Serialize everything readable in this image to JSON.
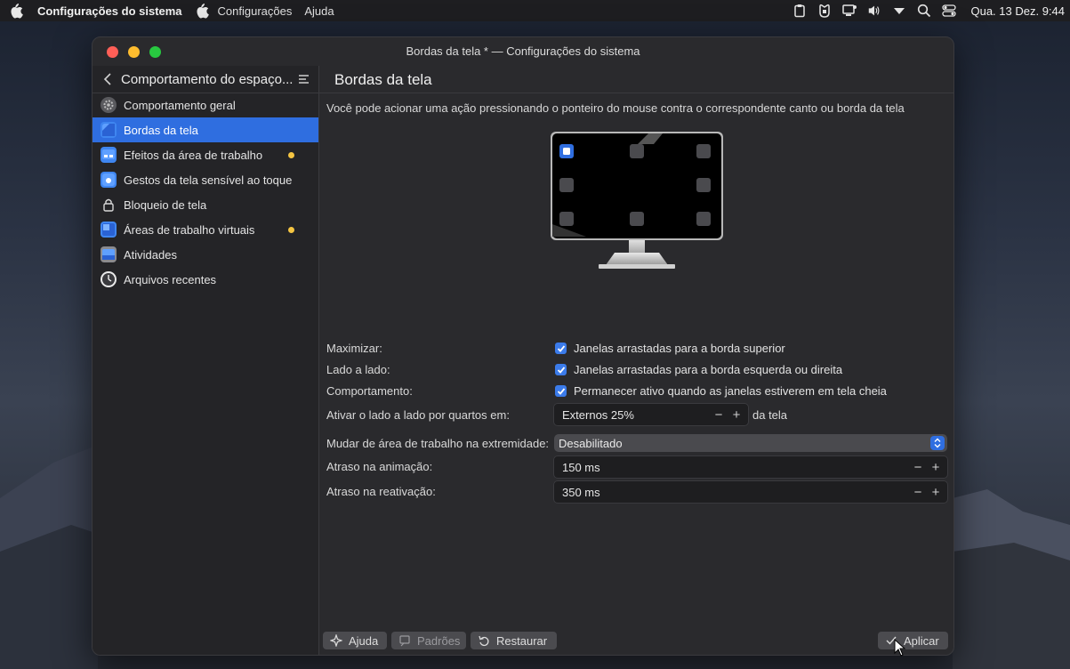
{
  "menubar": {
    "app_name": "Configurações do sistema",
    "items": [
      "Configurações",
      "Ajuda"
    ],
    "clock": "Qua. 13 Dez. 9:44"
  },
  "window": {
    "title": "Bordas da tela * — Configurações do sistema"
  },
  "sidebar": {
    "header": "Comportamento do espaço...",
    "items": [
      {
        "label": "Comportamento geral",
        "icon": "gear-icon",
        "active": false,
        "dot": false
      },
      {
        "label": "Bordas da tela",
        "icon": "screen-edges-icon",
        "active": true,
        "dot": false
      },
      {
        "label": "Efeitos da área de trabalho",
        "icon": "desktop-effects-icon",
        "active": false,
        "dot": true
      },
      {
        "label": "Gestos da tela sensível ao toque",
        "icon": "touch-gesture-icon",
        "active": false,
        "dot": false
      },
      {
        "label": "Bloqueio de tela",
        "icon": "lock-icon",
        "active": false,
        "dot": false
      },
      {
        "label": "Áreas de trabalho virtuais",
        "icon": "virtual-desktops-icon",
        "active": false,
        "dot": true
      },
      {
        "label": "Atividades",
        "icon": "activities-icon",
        "active": false,
        "dot": false
      },
      {
        "label": "Arquivos recentes",
        "icon": "clock-icon",
        "active": false,
        "dot": false
      }
    ]
  },
  "content": {
    "title": "Bordas da tela",
    "description": "Você pode acionar uma ação pressionando o ponteiro do mouse contra o correspondente canto ou borda da tela",
    "maximize": {
      "label": "Maximizar:",
      "text": "Janelas arrastadas para a borda superior",
      "checked": true
    },
    "tile": {
      "label": "Lado a lado:",
      "text": "Janelas arrastadas para a borda esquerda ou direita",
      "checked": true
    },
    "behavior": {
      "label": "Comportamento:",
      "text": "Permanecer ativo quando as janelas estiverem em tela cheia",
      "checked": true
    },
    "quarter": {
      "label": "Ativar o lado a lado por quartos em:",
      "value": "Externos 25%",
      "suffix": "da tela"
    },
    "switch_desktop": {
      "label": "Mudar de área de trabalho na extremidade:",
      "value": "Desabilitado"
    },
    "anim_delay": {
      "label": "Atraso na animação:",
      "value": "150 ms"
    },
    "react_delay": {
      "label": "Atraso na reativação:",
      "value": "350 ms"
    }
  },
  "footer": {
    "help": "Ajuda",
    "defaults": "Padrões",
    "reset": "Restaurar",
    "apply": "Aplicar"
  },
  "colors": {
    "accent": "#2f6ee0",
    "dot": "#f5c542"
  }
}
